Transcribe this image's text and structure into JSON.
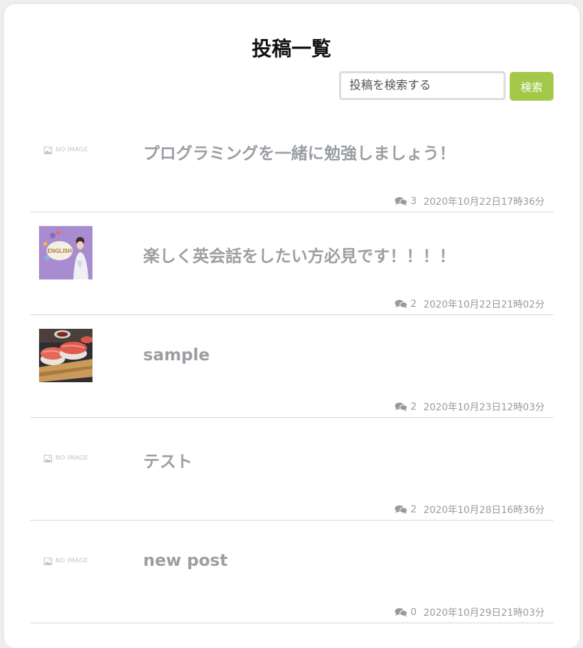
{
  "header": {
    "title": "投稿一覧"
  },
  "search": {
    "placeholder": "投稿を検索する",
    "button_label": "検索"
  },
  "colors": {
    "accent": "#a4c94a",
    "title_gray": "#9b9fa3"
  },
  "posts": [
    {
      "title": "プログラミングを一緒に勉強しましょう！",
      "thumbnail": "no-image",
      "no_image_label": "NO IMAGE",
      "comments": "3",
      "date": "2020年10月22日17時36分"
    },
    {
      "title": "楽しく英会話をしたい方必見です！！！！",
      "thumbnail": "english-photo",
      "thumb_text": "ENGLISH",
      "comments": "2",
      "date": "2020年10月22日21時02分"
    },
    {
      "title": "sample",
      "thumbnail": "sushi-photo",
      "comments": "2",
      "date": "2020年10月23日12時03分"
    },
    {
      "title": "テスト",
      "thumbnail": "no-image",
      "no_image_label": "NO IMAGE",
      "comments": "2",
      "date": "2020年10月28日16時36分"
    },
    {
      "title": "new post",
      "thumbnail": "no-image",
      "no_image_label": "NO IMAGE",
      "comments": "0",
      "date": "2020年10月29日21時03分"
    }
  ]
}
